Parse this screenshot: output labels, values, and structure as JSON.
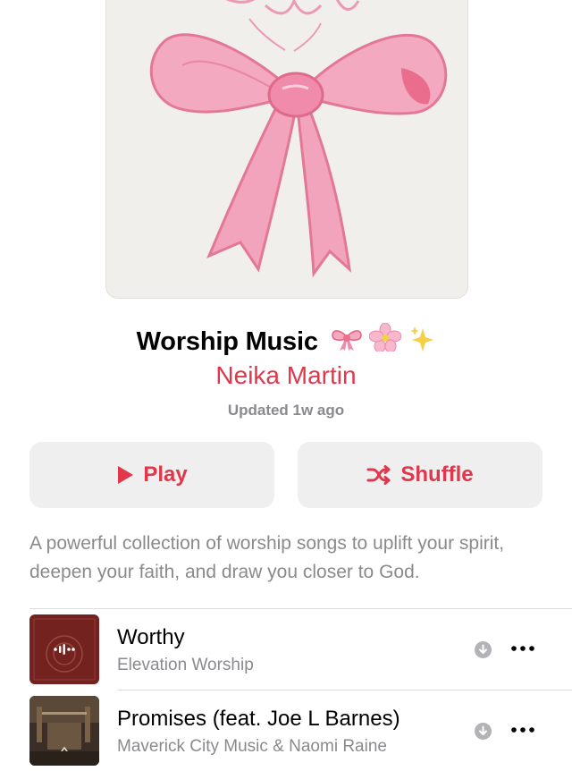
{
  "playlist": {
    "title": "Worship Music",
    "title_emojis": [
      "ribbon-emoji",
      "cherry-blossom-emoji",
      "sparkles-emoji"
    ],
    "curator": "Neika Martin",
    "updated": "Updated 1w ago",
    "description": "A powerful collection of worship songs to uplift your spirit, deepen your faith, and draw you closer to God.",
    "artwork_icon": "pink-bow-watercolor"
  },
  "actions": {
    "play_label": "Play",
    "play_icon": "play-icon",
    "shuffle_label": "Shuffle",
    "shuffle_icon": "shuffle-icon"
  },
  "tracks": [
    {
      "title": "Worthy",
      "artist": "Elevation Worship",
      "now_playing": true,
      "download_icon": "download-icon",
      "more_icon": "more-icon"
    },
    {
      "title": "Promises (feat. Joe L Barnes)",
      "artist": "Maverick City Music & Naomi Raine",
      "now_playing": false,
      "download_icon": "download-icon",
      "more_icon": "more-icon"
    }
  ],
  "colors": {
    "accent": "#e0374c",
    "button_bg": "#efeff0",
    "secondary_text": "#8a8a8e",
    "artwork_bg": "#f1efec",
    "bow_pink": "#ee8fae"
  }
}
